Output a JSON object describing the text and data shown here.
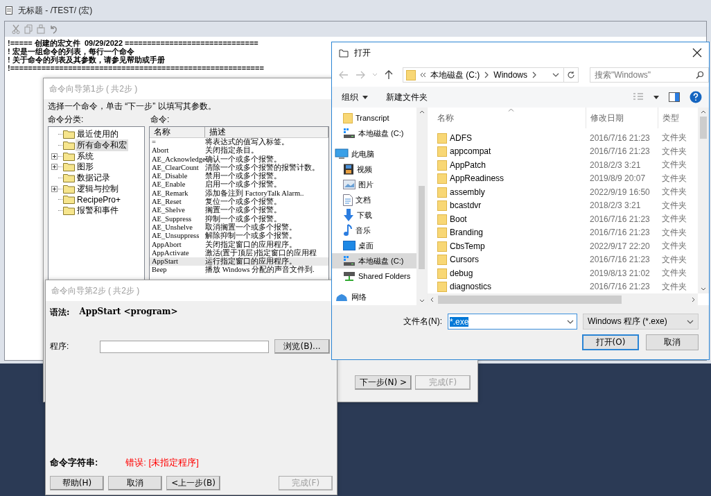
{
  "editor": {
    "title": "无标题 - /TEST/ (宏)",
    "lines": [
      "!===== 创建的宏文件  09/29/2022 ==============================",
      "! 宏是一组命令的列表，每行一个命令",
      "! 关于命令的列表及其参数，请参见帮助或手册",
      "!========================================================="
    ]
  },
  "wizard_step1": {
    "title": "命令向导第1步 ( 共2步 )",
    "instruction": "选择一个命令，单击 “下一步” 以填写其参数。",
    "categories_label": "命令分类:",
    "commands_label": "命令:",
    "categories": [
      {
        "label": "最近使用的",
        "expandable": false,
        "selected": false
      },
      {
        "label": "所有命令和宏",
        "expandable": false,
        "selected": true
      },
      {
        "label": "系统",
        "expandable": true,
        "selected": false
      },
      {
        "label": "图形",
        "expandable": true,
        "selected": false
      },
      {
        "label": "数据记录",
        "expandable": false,
        "selected": false
      },
      {
        "label": "逻辑与控制",
        "expandable": true,
        "selected": false
      },
      {
        "label": "RecipePro+",
        "expandable": false,
        "selected": false
      },
      {
        "label": "报警和事件",
        "expandable": false,
        "selected": false
      }
    ],
    "columns": [
      "名称",
      "描述"
    ],
    "commands": [
      {
        "name": "=",
        "description": "将表达式的值写入标签。",
        "selected": false
      },
      {
        "name": "Abort",
        "description": "关闭指定条目。",
        "selected": false
      },
      {
        "name": "AE_Acknowledge",
        "description": "确认一个或多个报警。",
        "selected": false
      },
      {
        "name": "AE_ClearCount",
        "description": "清除一个或多个报警的报警计数。",
        "selected": false
      },
      {
        "name": "AE_Disable",
        "description": "禁用一个或多个报警。",
        "selected": false
      },
      {
        "name": "AE_Enable",
        "description": "启用一个或多个报警。",
        "selected": false
      },
      {
        "name": "AE_Remark",
        "description": "添加备注到 FactoryTalk Alarm..",
        "selected": false
      },
      {
        "name": "AE_Reset",
        "description": "复位一个或多个报警。",
        "selected": false
      },
      {
        "name": "AE_Shelve",
        "description": "搁置一个或多个报警。",
        "selected": false
      },
      {
        "name": "AE_Suppress",
        "description": "抑制一个或多个报警。",
        "selected": false
      },
      {
        "name": "AE_Unshelve",
        "description": "取消搁置一个或多个报警。",
        "selected": false
      },
      {
        "name": "AE_Unsuppress",
        "description": "解除抑制一个或多个报警。",
        "selected": false
      },
      {
        "name": "AppAbort",
        "description": "关闭指定窗口的应用程序。",
        "selected": false
      },
      {
        "name": "AppActivate",
        "description": "激活(置于顶层)指定窗口的应用程",
        "selected": false
      },
      {
        "name": "AppStart",
        "description": "运行指定窗口的应用程序。",
        "selected": true
      },
      {
        "name": "Beep",
        "description": "播放 Windows 分配的声音文件到.",
        "selected": false
      }
    ],
    "buttons": [
      {
        "label": "下一步(N) >",
        "disabled": false
      },
      {
        "label": "完成(F)",
        "disabled": true
      }
    ]
  },
  "wizard_step2": {
    "title": "命令向导第2步 ( 共2步 )",
    "syntax_label": "语法:",
    "syntax": "AppStart <program>",
    "program_label": "程序:",
    "browse_button": "浏览(B)...",
    "command_string_label": "命令字符串:",
    "error": "错误:  [未指定程序]",
    "buttons": [
      {
        "label": "帮助(H)",
        "disabled": false
      },
      {
        "label": "取消",
        "disabled": false
      },
      {
        "label": "<上一步(B)",
        "disabled": false
      },
      {
        "label": "完成(F)",
        "disabled": true
      }
    ]
  },
  "file_dialog": {
    "title": "打开",
    "breadcrumb": [
      "本地磁盘 (C:)",
      "Windows"
    ],
    "search": {
      "placeholder": "搜索\"Windows\""
    },
    "toolbar": [
      "组织",
      "新建文件夹"
    ],
    "nav": [
      {
        "label": "Transcript",
        "kind": "folder",
        "selected": false
      },
      {
        "label": "本地磁盘 (C:)",
        "kind": "drive",
        "selected": false
      },
      {
        "label": "此电脑",
        "kind": "pc",
        "selected": false,
        "children": [
          {
            "label": "视频",
            "kind": "video",
            "selected": false
          },
          {
            "label": "图片",
            "kind": "pictures",
            "selected": false
          },
          {
            "label": "文档",
            "kind": "document",
            "selected": false
          },
          {
            "label": "下载",
            "kind": "download",
            "selected": false
          },
          {
            "label": "音乐",
            "kind": "music",
            "selected": false
          },
          {
            "label": "桌面",
            "kind": "desktop",
            "selected": false
          },
          {
            "label": "本地磁盘 (C:)",
            "kind": "drive",
            "selected": true
          },
          {
            "label": "Shared Folders",
            "kind": "share",
            "selected": false
          }
        ]
      },
      {
        "label": "网络",
        "kind": "network",
        "selected": false
      }
    ],
    "columns": [
      "名称",
      "修改日期",
      "类型"
    ],
    "files": [
      {
        "name": "ADFS",
        "modified": "2016/7/16 21:23",
        "type": "文件夹"
      },
      {
        "name": "appcompat",
        "modified": "2016/7/16 21:23",
        "type": "文件夹"
      },
      {
        "name": "AppPatch",
        "modified": "2018/2/3 3:21",
        "type": "文件夹"
      },
      {
        "name": "AppReadiness",
        "modified": "2019/8/9 20:07",
        "type": "文件夹"
      },
      {
        "name": "assembly",
        "modified": "2022/9/19 16:50",
        "type": "文件夹"
      },
      {
        "name": "bcastdvr",
        "modified": "2018/2/3 3:21",
        "type": "文件夹"
      },
      {
        "name": "Boot",
        "modified": "2016/7/16 21:23",
        "type": "文件夹"
      },
      {
        "name": "Branding",
        "modified": "2016/7/16 21:23",
        "type": "文件夹"
      },
      {
        "name": "CbsTemp",
        "modified": "2022/9/17 22:20",
        "type": "文件夹"
      },
      {
        "name": "Cursors",
        "modified": "2016/7/16 21:23",
        "type": "文件夹"
      },
      {
        "name": "debug",
        "modified": "2019/8/13 21:02",
        "type": "文件夹"
      },
      {
        "name": "diagnostics",
        "modified": "2016/7/16 21:23",
        "type": "文件夹"
      }
    ],
    "file_name_label": "文件名(N):",
    "file_name": "*.exe",
    "file_type": "Windows 程序 (*.exe)",
    "buttons": [
      {
        "label": "打开(O)",
        "default": true
      },
      {
        "label": "取消",
        "default": false
      }
    ]
  }
}
